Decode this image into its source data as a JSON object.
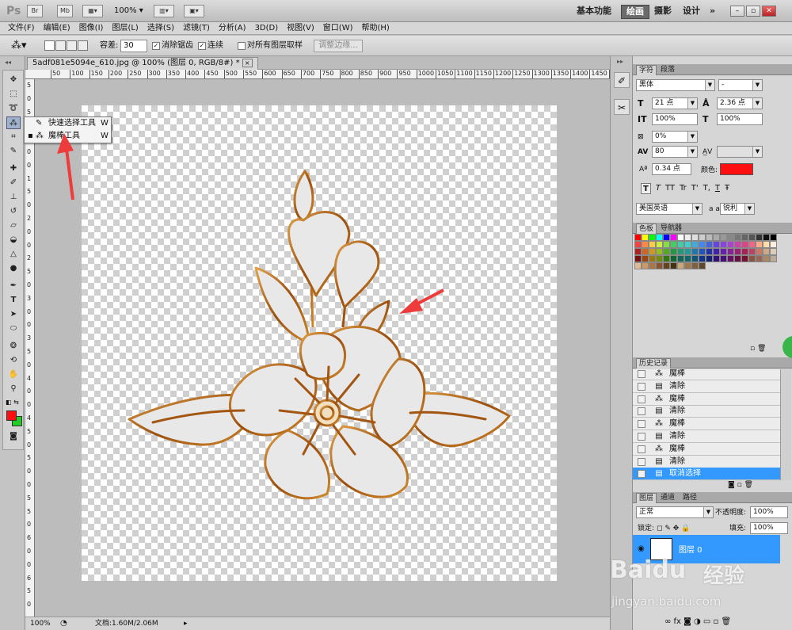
{
  "app": {
    "logo": "Ps",
    "zoom": "100%"
  },
  "topbar": {
    "br": "Br",
    "mb": "Mb",
    "workspaces": [
      "基本功能",
      "绘画",
      "摄影",
      "设计"
    ],
    "active_workspace": "绘画",
    "more": "»"
  },
  "menus": [
    "文件(F)",
    "编辑(E)",
    "图像(I)",
    "图层(L)",
    "选择(S)",
    "滤镜(T)",
    "分析(A)",
    "3D(D)",
    "视图(V)",
    "窗口(W)",
    "帮助(H)"
  ],
  "options": {
    "tolerance_label": "容差:",
    "tolerance_value": "30",
    "antialias_label": "消除锯齿",
    "contiguous_label": "连续",
    "sample_all_label": "对所有图层取样",
    "refine_edge_label": "调整边缘..."
  },
  "document": {
    "tab_title": "5adf081e5094e_610.jpg @ 100% (图层 0, RGB/8#) *",
    "close": "×"
  },
  "ruler_h": [
    "50",
    "100",
    "150",
    "200",
    "250",
    "300",
    "350",
    "400",
    "450",
    "500",
    "550",
    "600",
    "650",
    "700",
    "750",
    "800",
    "850",
    "900",
    "950",
    "1000",
    "1050",
    "1100",
    "1150",
    "1200",
    "1250",
    "1300",
    "1350",
    "1400",
    "1450",
    "1500",
    "1550",
    "1600",
    "1650",
    "1700"
  ],
  "ruler_v": [
    "5",
    "0",
    "5",
    "0",
    "1",
    "0",
    "0",
    "1",
    "5",
    "0",
    "2",
    "0",
    "0",
    "2",
    "5",
    "0",
    "3",
    "0",
    "0",
    "3",
    "5",
    "0",
    "4",
    "0",
    "0",
    "4",
    "5",
    "0",
    "5",
    "0",
    "0",
    "5",
    "5",
    "0",
    "6",
    "0",
    "0",
    "6",
    "5",
    "0"
  ],
  "flyout": {
    "items": [
      {
        "label": "快速选择工具",
        "key": "W",
        "selected": false
      },
      {
        "label": "魔棒工具",
        "key": "W",
        "selected": true
      }
    ]
  },
  "status": {
    "zoom": "100%",
    "doc": "文档:1.60M/2.06M"
  },
  "character": {
    "tabs": [
      "字符",
      "段落"
    ],
    "font": "黑体",
    "style": "-",
    "size": "21 点",
    "leading": "2.36 点",
    "vscale": "100%",
    "hscale": "100%",
    "kerning": "0%",
    "tracking": "80",
    "baseline": "0.34 点",
    "color_label": "颜色:",
    "color": "#ff1010",
    "language": "美国英语",
    "aa_label": "a a",
    "antialias": "锐利",
    "styles": [
      "T",
      "T",
      "TT",
      "Tr",
      "T'",
      "T,",
      "T",
      "Ŧ"
    ]
  },
  "swatches": {
    "tabs": [
      "色板",
      "导航器"
    ]
  },
  "history": {
    "tab": "历史记录",
    "items": [
      "魔棒",
      "清除",
      "魔棒",
      "清除",
      "魔棒",
      "清除",
      "魔棒",
      "清除",
      "取消选择"
    ],
    "selected": 8
  },
  "layers": {
    "tabs": [
      "图层",
      "通道",
      "路径"
    ],
    "blend": "正常",
    "opacity_label": "不透明度:",
    "opacity": "100%",
    "lock_label": "锁定:",
    "fill_label": "填充:",
    "fill": "100%",
    "layer_name": "图层 0"
  },
  "watermark": {
    "brand": "Baidu",
    "cn": "经验",
    "url": "jingyan.baidu.com"
  },
  "colors": {
    "fg": "#ff1010",
    "bg": "#22cc22",
    "accent": "#3399ff",
    "flower_stroke": "#b8661a"
  }
}
